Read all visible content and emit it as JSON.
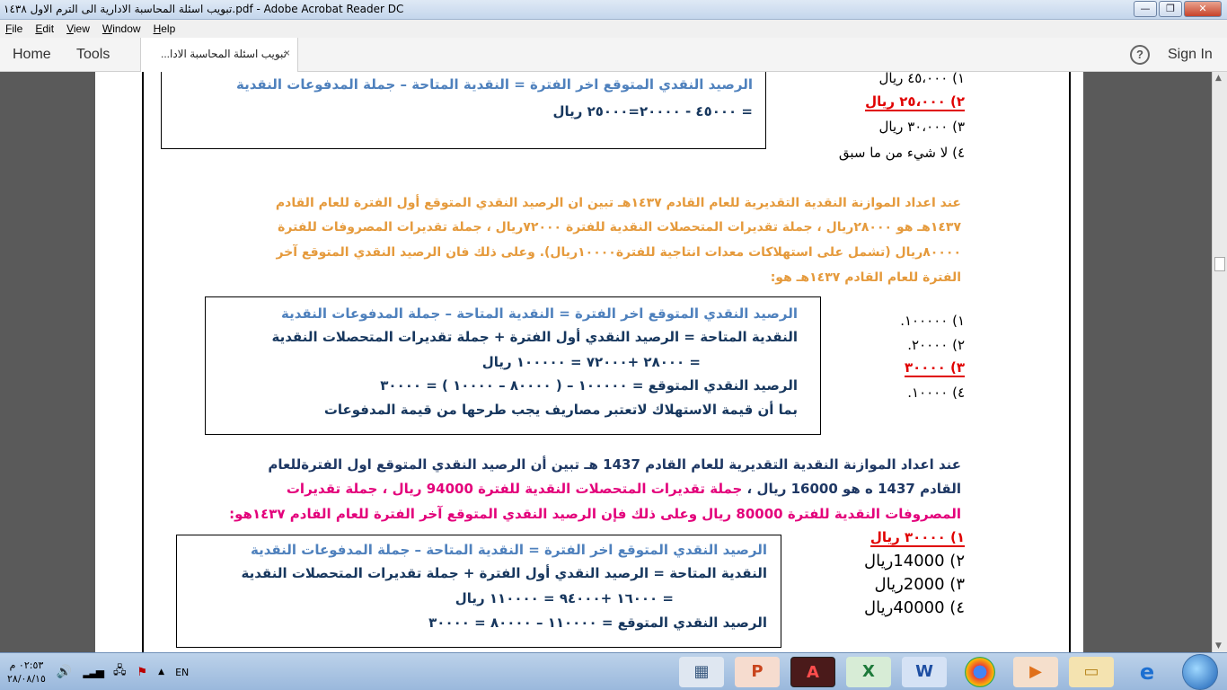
{
  "window": {
    "title": "تبويب اسئلة  المحاسبة الادارية الى الترم الاول ١٤٣٨.pdf - Adobe Acrobat Reader DC",
    "btn_min": "—",
    "btn_max": "❐",
    "btn_close": "✕"
  },
  "menu": [
    "File",
    "Edit",
    "View",
    "Window",
    "Help"
  ],
  "toolbar": {
    "home": "Home",
    "tools": "Tools",
    "doc_tab": "تبويب اسئلة  المحاسبة الادا...",
    "doc_tab_close": "×",
    "help": "?",
    "sign_in": "Sign In"
  },
  "q1": {
    "box_line1": "الرصيد النقدي المتوقع  اخر الفترة = النقدية المتاحة – جملة المدفوعات النقدية",
    "box_line2": "= ٤٥٠٠٠ - ٢٠٠٠٠=٢٥٠٠٠ ريال",
    "options": [
      "١)  ٤٥،٠٠٠ ريال",
      "٢)  ٢٥،٠٠٠ ريال",
      "٣)  ٣٠،٠٠٠ ريال",
      "٤)  لا شيء من ما سبق"
    ]
  },
  "q2": {
    "text": [
      "عند اعداد الموازنة النقدية التقديرية للعام القادم ١٤٣٧هـ تبين ان الرصيد النقدي المتوقع أول الفترة للعام القادم",
      "١٤٣٧هـ هو ٢٨٠٠٠ريال ، جملة تقديرات المتحصلات النقدية للفترة ٧٢٠٠٠ريال ، جملة تقديرات المصروفات للفترة",
      "٨٠٠٠٠ريال (تشمل على استهلاكات معدات انتاجية للفترة١٠٠٠٠ريال). وعلى ذلك فان الرصيد النقدي المتوقع آخر",
      "الفترة للعام القادم ١٤٣٧هـ هو:"
    ],
    "box": [
      "الرصيد النقدي المتوقع  اخر الفترة = النقدية المتاحة – جملة المدفوعات النقدية",
      "النقدية المتاحة = الرصيد النقدي أول الفترة + جملة تقديرات المتحصلات النقدية",
      "= ٢٨٠٠٠ +٧٢٠٠٠ = ١٠٠٠٠٠ ريال",
      "الرصيد النقدي المتوقع = ١٠٠٠٠٠  – ( ٨٠٠٠٠ – ١٠٠٠٠ ) = ٣٠٠٠٠",
      "بما أن قيمة الاستهلاك لاتعتبر مصاريف يجب طرحها من قيمة المدفوعات"
    ],
    "options": [
      "١)  ١٠٠٠٠٠.",
      "٢)  ٢٠٠٠٠.",
      "٣)  ٣٠٠٠٠",
      "٤)  ١٠٠٠٠."
    ]
  },
  "q3": {
    "line1": "عند اعداد الموازنة النقدية التقديرية للعام القادم  1437 هـ تبين أن الرصيد النقدي المتوقع اول الفترةللعام",
    "line2_a": "القادم 1437 ه هو  16000 ريال ، ",
    "line2_b": "جملة تقديرات المتحصلات النقدية للفترة 94000 ريال ، جملة تقديرات",
    "line3": "المصروفات النقدية للفترة 80000 ريال وعلى ذلك فإن الرصيد النقدي المتوقع آخر الفترة للعام القادم ١٤٣٧هو:",
    "box": [
      "الرصيد النقدي المتوقع  اخر الفترة = النقدية المتاحة – جملة المدفوعات النقدية",
      "النقدية المتاحة = الرصيد النقدي أول الفترة + جملة تقديرات المتحصلات النقدية",
      "= ١٦٠٠٠ +٩٤٠٠٠ = ١١٠٠٠٠ ريال",
      "الرصيد النقدي المتوقع = ١١٠٠٠٠  – ٨٠٠٠٠  =  ٣٠٠٠٠"
    ],
    "options": [
      "١)  ٣٠٠٠٠ ريال",
      "٢)  14000ريال",
      "٣)  2000ريال",
      "٤)  40000ريال"
    ]
  },
  "taskbar": {
    "time": "٠٢:٥٣ م",
    "date": "٢٨/٠٨/١٥",
    "lang": "EN",
    "tray_arrow": "▲"
  }
}
